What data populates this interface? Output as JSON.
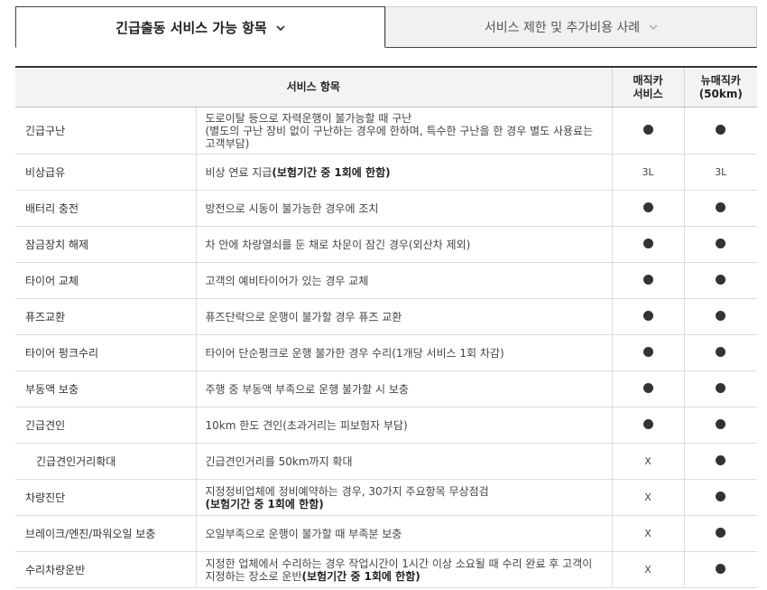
{
  "tabs": [
    {
      "label": "긴급출동 서비스 가능 항목",
      "icon": "chevron-down-icon"
    },
    {
      "label": "서비스 제한 및 추가비용 사례",
      "icon": "chevron-down-icon"
    }
  ],
  "table": {
    "headers": {
      "item": "서비스 항목",
      "magic_line1": "매직카",
      "magic_line2": "서비스",
      "new_line1": "뉴매직카",
      "new_line2": "(50km)"
    },
    "rows": [
      {
        "name": "긴급구난",
        "desc": "도로이탈 등으로 자력운행이 불가능할 때 구난",
        "desc2": "(별도의 구난 장비 없이 구난하는 경우에 한하며, 특수한 구난을 한 경우 별도 사용료는 고객부담)",
        "magic": "●",
        "new": "●"
      },
      {
        "name": "비상급유",
        "desc": "비상 연료 지급",
        "desc_bold": "(보험기간 중 1회에 한함)",
        "magic": "3L",
        "new": "3L"
      },
      {
        "name": "배터리 충전",
        "desc": "방전으로 시동이 불가능한 경우에 조치",
        "magic": "●",
        "new": "●"
      },
      {
        "name": "잠금장치 해제",
        "desc": "차 안에 차량열쇠를 둔 채로 차문이 잠긴 경우(외산차 제외)",
        "magic": "●",
        "new": "●"
      },
      {
        "name": "타이어 교체",
        "desc": "고객의 예비타이어가 있는 경우 교체",
        "magic": "●",
        "new": "●"
      },
      {
        "name": "퓨즈교환",
        "desc": "퓨즈단락으로 운행이 불가할 경우 퓨즈 교환",
        "magic": "●",
        "new": "●"
      },
      {
        "name": "타이어 펑크수리",
        "desc": "타이어 단순펑크로 운행 불가한 경우 수리(1개당 서비스 1회 차감)",
        "magic": "●",
        "new": "●"
      },
      {
        "name": "부동액 보충",
        "desc": "주행 중 부동액 부족으로 운행 불가할 시 보충",
        "magic": "●",
        "new": "●"
      },
      {
        "name": "긴급견인",
        "desc": "10km 한도 견인(초과거리는 피보험자 부담)",
        "magic": "●",
        "new": "●"
      },
      {
        "name": "긴급견인거리확대",
        "desc": "긴급견인거리를 50km까지 확대",
        "magic": "X",
        "new": "●"
      },
      {
        "name": "차량진단",
        "desc": "지정정비업체에 정비예약하는 경우, 30가지 주요항목 무상점검",
        "desc_bold": "(보험기간 중 1회에 한함)",
        "magic": "X",
        "new": "●"
      },
      {
        "name": "브레이크/엔진/파워오일 보충",
        "desc": "오일부족으로 운행이 불가할 때 부족분 보충",
        "magic": "X",
        "new": "●"
      },
      {
        "name": "수리차량운반",
        "desc": "지정한 업체에서 수리하는 경우 작업시간이 1시간 이상 소요될 때 수리 완료 후 고객이 지정하는 장소로 운반",
        "desc_bold": "(보험기간 중 1회에 한함)",
        "magic": "X",
        "new": "●"
      }
    ]
  }
}
